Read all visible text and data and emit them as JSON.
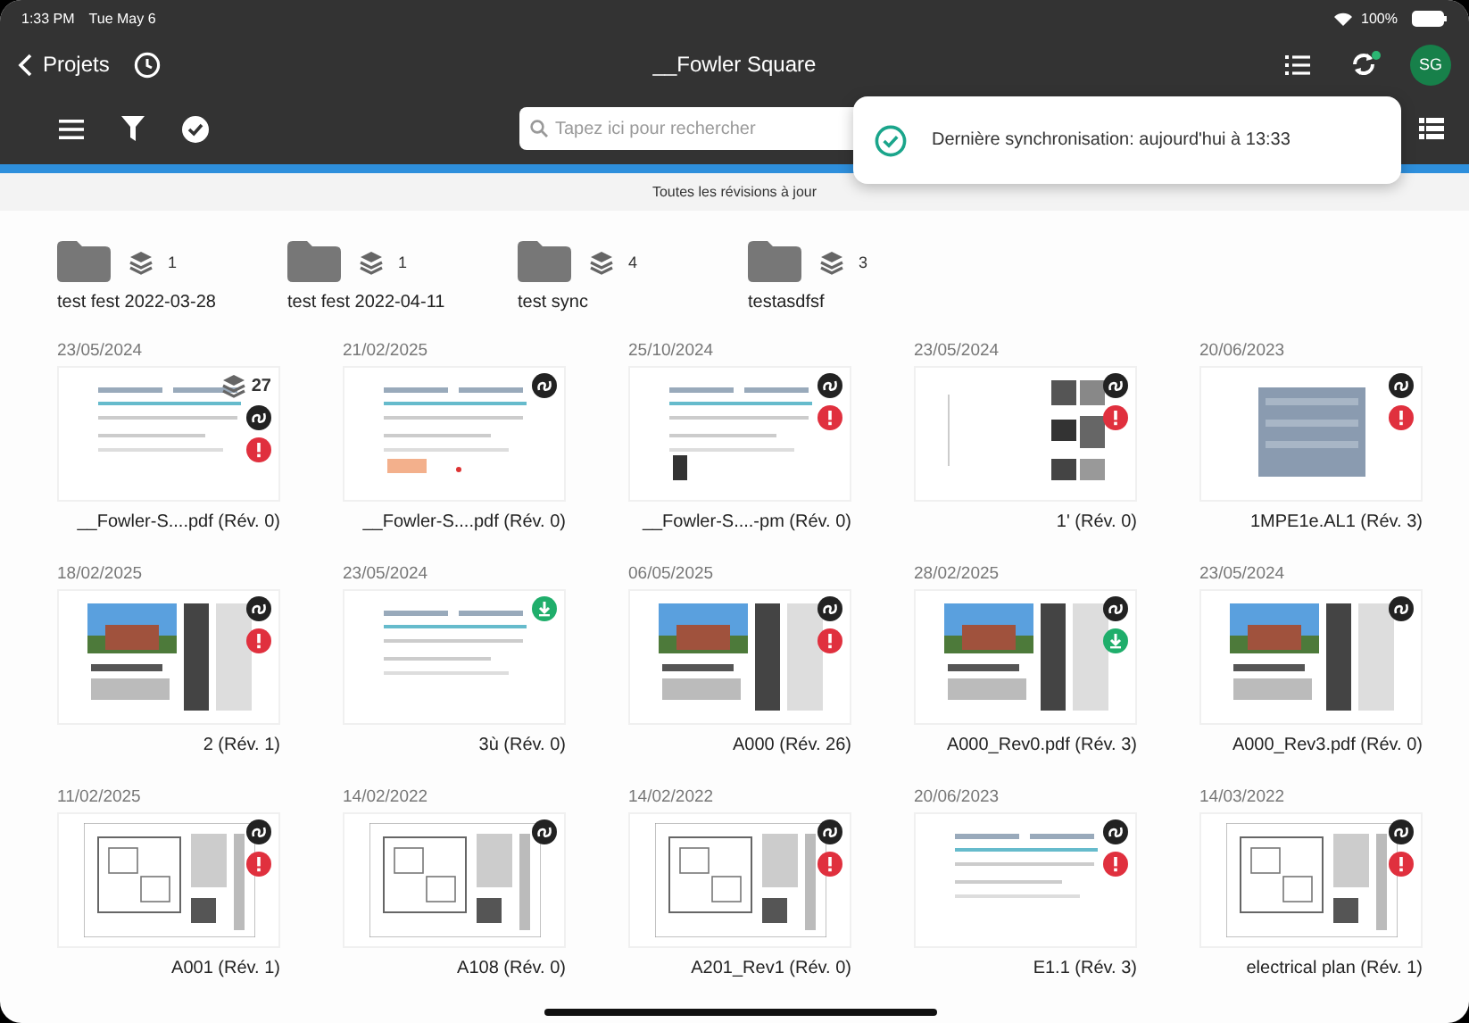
{
  "status_bar": {
    "time": "1:33 PM",
    "date": "Tue May 6",
    "battery": "100%"
  },
  "nav": {
    "back": "Projets",
    "title": "__Fowler Square",
    "avatar": "SG"
  },
  "search": {
    "placeholder": "Tapez ici pour rechercher"
  },
  "toast": {
    "message": "Dernière synchronisation: aujourd'hui à 13:33"
  },
  "sync_progress": {
    "level": 1
  },
  "sync_status": "Toutes les révisions à jour",
  "folders": [
    {
      "name": "test fest 2022-03-28",
      "count": "1"
    },
    {
      "name": "test fest 2022-04-11",
      "count": "1"
    },
    {
      "name": "test sync",
      "count": "4"
    },
    {
      "name": "testasdfsf",
      "count": "3"
    }
  ],
  "documents": [
    {
      "date": "23/05/2024",
      "name": "__Fowler-S....pdf (Rév. 0)",
      "layers": "27",
      "linked": true,
      "alert": true,
      "downloadable": false
    },
    {
      "date": "21/02/2025",
      "name": "__Fowler-S....pdf (Rév. 0)",
      "linked": true,
      "alert": false,
      "downloadable": false
    },
    {
      "date": "25/10/2024",
      "name": "__Fowler-S....-pm (Rév. 0)",
      "linked": true,
      "alert": true,
      "downloadable": false
    },
    {
      "date": "23/05/2024",
      "name": "1' (Rév. 0)",
      "linked": true,
      "alert": true,
      "downloadable": false
    },
    {
      "date": "20/06/2023",
      "name": "1MPE1e.AL1 (Rév. 3)",
      "linked": true,
      "alert": true,
      "downloadable": false
    },
    {
      "date": "18/02/2025",
      "name": "2 (Rév. 1)",
      "linked": true,
      "alert": true,
      "downloadable": false
    },
    {
      "date": "23/05/2024",
      "name": "3ù (Rév. 0)",
      "linked": false,
      "alert": false,
      "downloadable": true
    },
    {
      "date": "06/05/2025",
      "name": "A000 (Rév. 26)",
      "linked": true,
      "alert": true,
      "downloadable": false
    },
    {
      "date": "28/02/2025",
      "name": "A000_Rev0.pdf (Rév. 3)",
      "linked": true,
      "alert": false,
      "downloadable": true
    },
    {
      "date": "23/05/2024",
      "name": "A000_Rev3.pdf (Rév. 0)",
      "linked": true,
      "alert": false,
      "downloadable": false
    },
    {
      "date": "11/02/2025",
      "name": "A001 (Rév. 1)",
      "linked": true,
      "alert": true,
      "downloadable": false
    },
    {
      "date": "14/02/2022",
      "name": "A108 (Rév. 0)",
      "linked": true,
      "alert": false,
      "downloadable": false
    },
    {
      "date": "14/02/2022",
      "name": "A201_Rev1 (Rév. 0)",
      "linked": true,
      "alert": true,
      "downloadable": false
    },
    {
      "date": "20/06/2023",
      "name": "E1.1 (Rév. 3)",
      "linked": true,
      "alert": true,
      "downloadable": false
    },
    {
      "date": "14/03/2022",
      "name": "electrical plan (Rév. 1)",
      "linked": true,
      "alert": true,
      "downloadable": false
    }
  ]
}
